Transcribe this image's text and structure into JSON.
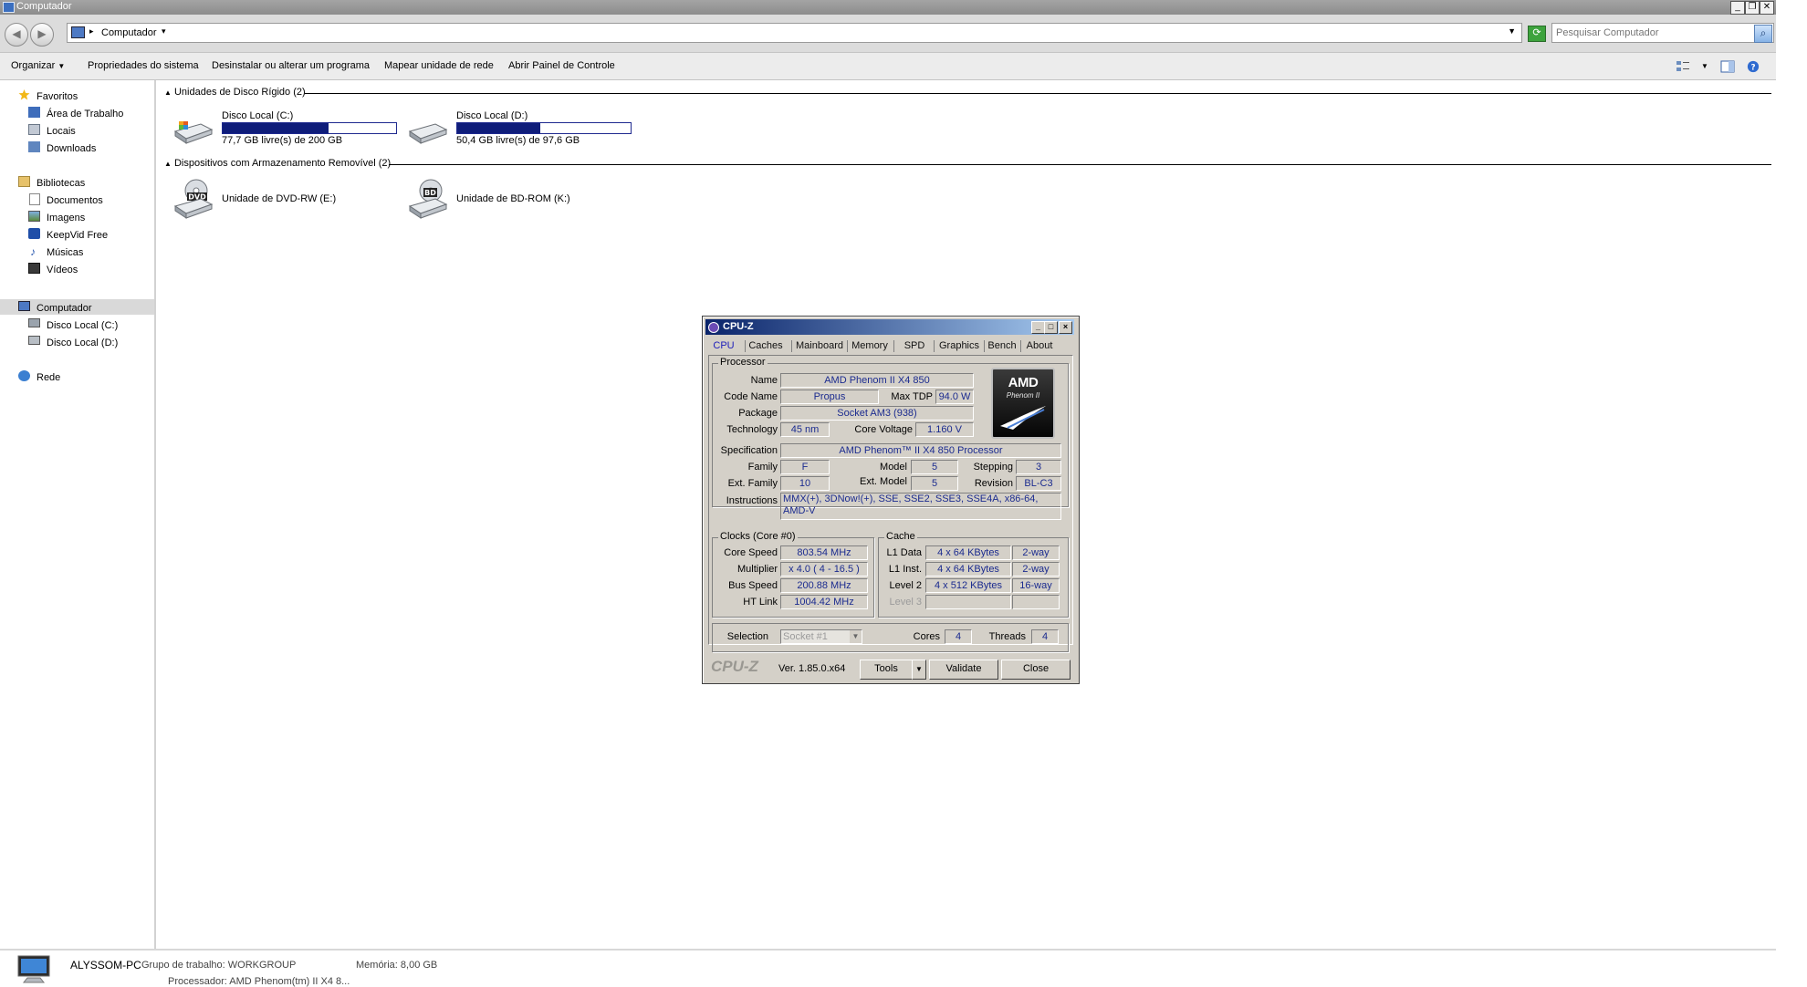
{
  "window": {
    "title": "Computador"
  },
  "address": {
    "crumb": "Computador",
    "search_placeholder": "Pesquisar Computador"
  },
  "toolbar": {
    "organize": "Organizar",
    "system_props": "Propriedades do sistema",
    "uninstall": "Desinstalar ou alterar um programa",
    "map_drive": "Mapear unidade de rede",
    "control_panel": "Abrir Painel de Controle"
  },
  "nav": {
    "favorites": "Favoritos",
    "desktop": "Área de Trabalho",
    "places": "Locais",
    "downloads": "Downloads",
    "libraries": "Bibliotecas",
    "documents": "Documentos",
    "images": "Imagens",
    "keepvid": "KeepVid Free",
    "music": "Músicas",
    "videos": "Vídeos",
    "computer": "Computador",
    "drive_c": "Disco Local (C:)",
    "drive_d": "Disco Local (D:)",
    "network": "Rede"
  },
  "content": {
    "hdd_group": "Unidades de Disco Rígido (2)",
    "removable_group": "Dispositivos com Armazenamento Removível (2)",
    "drives": [
      {
        "name": "Disco Local (C:)",
        "free": "77,7 GB livre(s) de 200 GB",
        "used_fraction": 0.61
      },
      {
        "name": "Disco Local (D:)",
        "free": "50,4 GB livre(s) de 97,6 GB",
        "used_fraction": 0.48
      }
    ],
    "removable": [
      {
        "name": "Unidade de DVD-RW (E:)",
        "badge": "DVD"
      },
      {
        "name": "Unidade de BD-ROM (K:)",
        "badge": "BD"
      }
    ]
  },
  "details": {
    "pc_name": "ALYSSOM-PC",
    "workgroup": "Grupo de trabalho: WORKGROUP",
    "memory": "Memória: 8,00 GB",
    "processor": "Processador: AMD Phenom(tm) II X4 8..."
  },
  "cpuz": {
    "title": "CPU-Z",
    "tabs": [
      "CPU",
      "Caches",
      "Mainboard",
      "Memory",
      "SPD",
      "Graphics",
      "Bench",
      "About"
    ],
    "processor_label": "Processor",
    "labels": {
      "name": "Name",
      "code_name": "Code Name",
      "max_tdp": "Max TDP",
      "package": "Package",
      "technology": "Technology",
      "core_voltage": "Core Voltage",
      "specification": "Specification",
      "family": "Family",
      "model": "Model",
      "stepping": "Stepping",
      "ext_family": "Ext. Family",
      "ext_model": "Ext. Model",
      "revision": "Revision",
      "instructions": "Instructions"
    },
    "values": {
      "name": "AMD Phenom II X4 850",
      "code_name": "Propus",
      "max_tdp": "94.0 W",
      "package": "Socket AM3 (938)",
      "technology": "45 nm",
      "core_voltage": "1.160 V",
      "specification": "AMD Phenom™ II X4 850 Processor",
      "family": "F",
      "model": "5",
      "stepping": "3",
      "ext_family": "10",
      "ext_model": "5",
      "revision": "BL-C3",
      "instructions_line1": "MMX(+), 3DNow!(+), SSE, SSE2, SSE3, SSE4A, x86-64,",
      "instructions_line2": "AMD-V"
    },
    "logo": {
      "brand": "AMD",
      "sub": "Phenom II"
    },
    "clocks": {
      "label": "Clocks (Core #0)",
      "core_speed_label": "Core Speed",
      "core_speed": "803.54 MHz",
      "multiplier_label": "Multiplier",
      "multiplier": "x 4.0 ( 4 - 16.5 )",
      "bus_speed_label": "Bus Speed",
      "bus_speed": "200.88 MHz",
      "ht_link_label": "HT Link",
      "ht_link": "1004.42 MHz"
    },
    "cache": {
      "label": "Cache",
      "l1d_label": "L1 Data",
      "l1d": "4 x 64 KBytes",
      "l1d_way": "2-way",
      "l1i_label": "L1 Inst.",
      "l1i": "4 x 64 KBytes",
      "l1i_way": "2-way",
      "l2_label": "Level 2",
      "l2": "4 x 512 KBytes",
      "l2_way": "16-way",
      "l3_label": "Level 3"
    },
    "selection_label": "Selection",
    "selection": "Socket #1",
    "cores_label": "Cores",
    "cores": "4",
    "threads_label": "Threads",
    "threads": "4",
    "brand_footer": "CPU-Z",
    "version": "Ver. 1.85.0.x64",
    "tools": "Tools",
    "validate": "Validate",
    "close": "Close"
  },
  "colors": {
    "selection_bg": "#d9d9d9",
    "drive_bar": "#0f1d7a",
    "cpuz_title": "#0a246a"
  }
}
